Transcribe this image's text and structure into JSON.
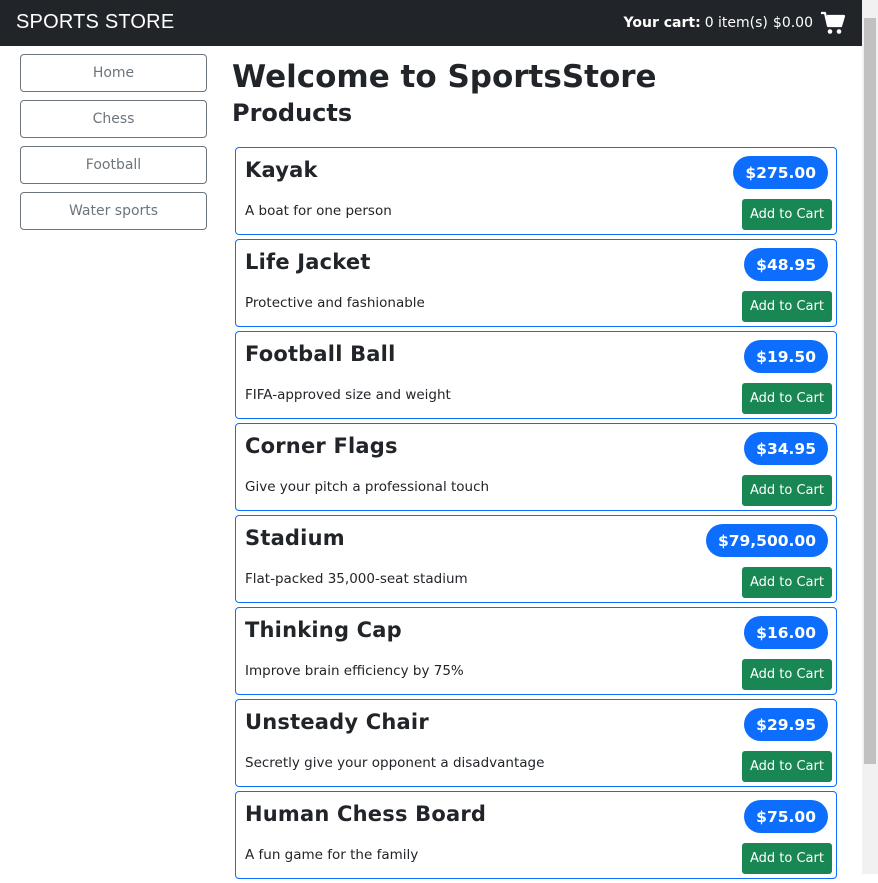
{
  "navbar": {
    "brand": "SPORTS STORE",
    "cart_label": "Your cart:",
    "cart_items": "0 item(s)",
    "cart_total": "$0.00",
    "cart_icon": "shopping-cart-icon"
  },
  "sidebar": {
    "items": [
      {
        "label": "Home"
      },
      {
        "label": "Chess"
      },
      {
        "label": "Football"
      },
      {
        "label": "Water sports"
      }
    ]
  },
  "main": {
    "title": "Welcome to SportsStore",
    "subtitle": "Products"
  },
  "products": [
    {
      "name": "Kayak",
      "description": "A boat for one person",
      "price": "$275.00",
      "button": "Add to Cart"
    },
    {
      "name": "Life Jacket",
      "description": "Protective and fashionable",
      "price": "$48.95",
      "button": "Add to Cart"
    },
    {
      "name": "Football Ball",
      "description": "FIFA-approved size and weight",
      "price": "$19.50",
      "button": "Add to Cart"
    },
    {
      "name": "Corner Flags",
      "description": "Give your pitch a professional touch",
      "price": "$34.95",
      "button": "Add to Cart"
    },
    {
      "name": "Stadium",
      "description": "Flat-packed 35,000-seat stadium",
      "price": "$79,500.00",
      "button": "Add to Cart"
    },
    {
      "name": "Thinking Cap",
      "description": "Improve brain efficiency by 75%",
      "price": "$16.00",
      "button": "Add to Cart"
    },
    {
      "name": "Unsteady Chair",
      "description": "Secretly give your opponent a disadvantage",
      "price": "$29.95",
      "button": "Add to Cart"
    },
    {
      "name": "Human Chess Board",
      "description": "A fun game for the family",
      "price": "$75.00",
      "button": "Add to Cart"
    }
  ],
  "colors": {
    "navbar": "#212529",
    "primary": "#0d6efd",
    "success": "#198754",
    "secondary": "#6c757d"
  }
}
